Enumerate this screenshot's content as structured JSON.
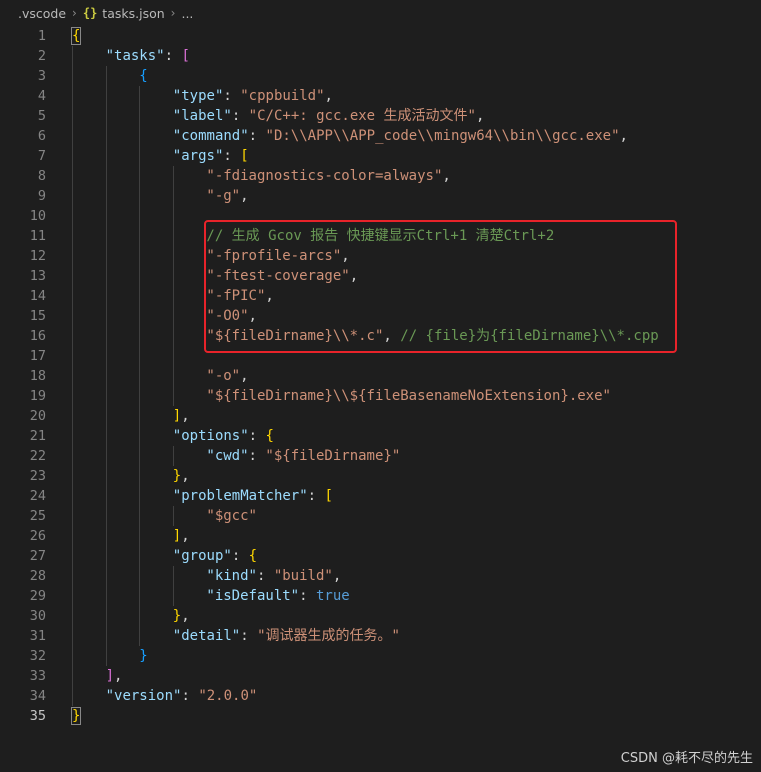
{
  "breadcrumb": {
    "folder": ".vscode",
    "file_icon": "{}",
    "file": "tasks.json",
    "trail": "..."
  },
  "editor": {
    "active_line": "35",
    "lines": [
      {
        "n": "1",
        "indent": 0,
        "tokens": [
          [
            "br1",
            "{"
          ]
        ]
      },
      {
        "n": "2",
        "indent": 1,
        "tokens": [
          [
            "k",
            "\"tasks\""
          ],
          [
            "p",
            ": "
          ],
          [
            "br2",
            "["
          ]
        ]
      },
      {
        "n": "3",
        "indent": 2,
        "tokens": [
          [
            "br3",
            "{"
          ]
        ]
      },
      {
        "n": "4",
        "indent": 3,
        "tokens": [
          [
            "k",
            "\"type\""
          ],
          [
            "p",
            ": "
          ],
          [
            "s",
            "\"cppbuild\""
          ],
          [
            "p",
            ","
          ]
        ]
      },
      {
        "n": "5",
        "indent": 3,
        "tokens": [
          [
            "k",
            "\"label\""
          ],
          [
            "p",
            ": "
          ],
          [
            "s",
            "\"C/C++: gcc.exe 生成活动文件\""
          ],
          [
            "p",
            ","
          ]
        ]
      },
      {
        "n": "6",
        "indent": 3,
        "tokens": [
          [
            "k",
            "\"command\""
          ],
          [
            "p",
            ": "
          ],
          [
            "s",
            "\"D:\\\\APP\\\\APP_code\\\\mingw64\\\\bin\\\\gcc.exe\""
          ],
          [
            "p",
            ","
          ]
        ]
      },
      {
        "n": "7",
        "indent": 3,
        "tokens": [
          [
            "k",
            "\"args\""
          ],
          [
            "p",
            ": "
          ],
          [
            "br1",
            "["
          ]
        ]
      },
      {
        "n": "8",
        "indent": 4,
        "tokens": [
          [
            "s",
            "\"-fdiagnostics-color=always\""
          ],
          [
            "p",
            ","
          ]
        ]
      },
      {
        "n": "9",
        "indent": 4,
        "tokens": [
          [
            "s",
            "\"-g\""
          ],
          [
            "p",
            ","
          ]
        ]
      },
      {
        "n": "10",
        "indent": 4,
        "tokens": []
      },
      {
        "n": "11",
        "indent": 4,
        "tokens": [
          [
            "c",
            "// 生成 Gcov 报告 快捷键显示Ctrl+1 清楚Ctrl+2"
          ]
        ]
      },
      {
        "n": "12",
        "indent": 4,
        "tokens": [
          [
            "s",
            "\"-fprofile-arcs\""
          ],
          [
            "p",
            ","
          ]
        ]
      },
      {
        "n": "13",
        "indent": 4,
        "tokens": [
          [
            "s",
            "\"-ftest-coverage\""
          ],
          [
            "p",
            ","
          ]
        ]
      },
      {
        "n": "14",
        "indent": 4,
        "tokens": [
          [
            "s",
            "\"-fPIC\""
          ],
          [
            "p",
            ","
          ]
        ]
      },
      {
        "n": "15",
        "indent": 4,
        "tokens": [
          [
            "s",
            "\"-O0\""
          ],
          [
            "p",
            ","
          ]
        ]
      },
      {
        "n": "16",
        "indent": 4,
        "tokens": [
          [
            "s",
            "\"${fileDirname}\\\\*.c\""
          ],
          [
            "p",
            ", "
          ],
          [
            "c",
            "// {file}为{fileDirname}\\\\*.cpp"
          ]
        ]
      },
      {
        "n": "17",
        "indent": 4,
        "tokens": []
      },
      {
        "n": "18",
        "indent": 4,
        "tokens": [
          [
            "s",
            "\"-o\""
          ],
          [
            "p",
            ","
          ]
        ]
      },
      {
        "n": "19",
        "indent": 4,
        "tokens": [
          [
            "s",
            "\"${fileDirname}\\\\${fileBasenameNoExtension}.exe\""
          ]
        ]
      },
      {
        "n": "20",
        "indent": 3,
        "tokens": [
          [
            "br1",
            "]"
          ],
          [
            "p",
            ","
          ]
        ]
      },
      {
        "n": "21",
        "indent": 3,
        "tokens": [
          [
            "k",
            "\"options\""
          ],
          [
            "p",
            ": "
          ],
          [
            "br1",
            "{"
          ]
        ]
      },
      {
        "n": "22",
        "indent": 4,
        "tokens": [
          [
            "k",
            "\"cwd\""
          ],
          [
            "p",
            ": "
          ],
          [
            "s",
            "\"${fileDirname}\""
          ]
        ]
      },
      {
        "n": "23",
        "indent": 3,
        "tokens": [
          [
            "br1",
            "}"
          ],
          [
            "p",
            ","
          ]
        ]
      },
      {
        "n": "24",
        "indent": 3,
        "tokens": [
          [
            "k",
            "\"problemMatcher\""
          ],
          [
            "p",
            ": "
          ],
          [
            "br1",
            "["
          ]
        ]
      },
      {
        "n": "25",
        "indent": 4,
        "tokens": [
          [
            "s",
            "\"$gcc\""
          ]
        ]
      },
      {
        "n": "26",
        "indent": 3,
        "tokens": [
          [
            "br1",
            "]"
          ],
          [
            "p",
            ","
          ]
        ]
      },
      {
        "n": "27",
        "indent": 3,
        "tokens": [
          [
            "k",
            "\"group\""
          ],
          [
            "p",
            ": "
          ],
          [
            "br1",
            "{"
          ]
        ]
      },
      {
        "n": "28",
        "indent": 4,
        "tokens": [
          [
            "k",
            "\"kind\""
          ],
          [
            "p",
            ": "
          ],
          [
            "s",
            "\"build\""
          ],
          [
            "p",
            ","
          ]
        ]
      },
      {
        "n": "29",
        "indent": 4,
        "tokens": [
          [
            "k",
            "\"isDefault\""
          ],
          [
            "p",
            ": "
          ],
          [
            "b",
            "true"
          ]
        ]
      },
      {
        "n": "30",
        "indent": 3,
        "tokens": [
          [
            "br1",
            "}"
          ],
          [
            "p",
            ","
          ]
        ]
      },
      {
        "n": "31",
        "indent": 3,
        "tokens": [
          [
            "k",
            "\"detail\""
          ],
          [
            "p",
            ": "
          ],
          [
            "s",
            "\"调试器生成的任务。\""
          ]
        ]
      },
      {
        "n": "32",
        "indent": 2,
        "tokens": [
          [
            "br3",
            "}"
          ]
        ]
      },
      {
        "n": "33",
        "indent": 1,
        "tokens": [
          [
            "br2",
            "]"
          ],
          [
            "p",
            ","
          ]
        ]
      },
      {
        "n": "34",
        "indent": 1,
        "tokens": [
          [
            "k",
            "\"version\""
          ],
          [
            "p",
            ": "
          ],
          [
            "s",
            "\"2.0.0\""
          ]
        ]
      },
      {
        "n": "35",
        "indent": 0,
        "tokens": [
          [
            "br1",
            "}"
          ]
        ]
      }
    ]
  },
  "annotation": {
    "color": "#e8232a"
  },
  "watermark": "CSDN @耗不尽的先生"
}
